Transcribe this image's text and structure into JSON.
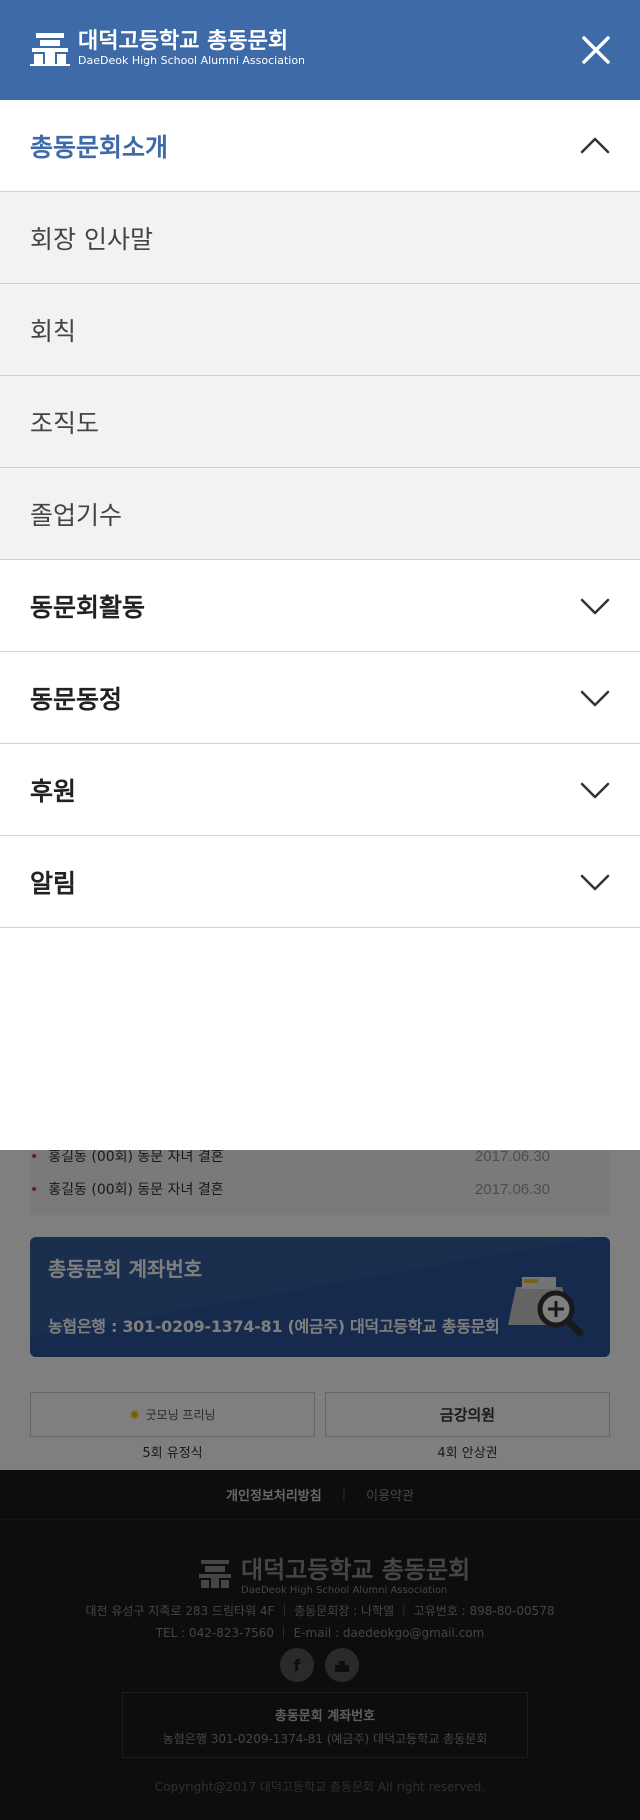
{
  "header": {
    "logo_kr": "대덕고등학교 총동문회",
    "logo_en": "DaeDeok High School Alumni Association"
  },
  "menu": {
    "items": [
      {
        "label": "총동문회소개",
        "expanded": true,
        "children": [
          {
            "label": "회장 인사말"
          },
          {
            "label": "회칙"
          },
          {
            "label": "조직도"
          },
          {
            "label": "졸업기수"
          }
        ]
      },
      {
        "label": "동문회활동",
        "expanded": false
      },
      {
        "label": "동문동정",
        "expanded": false
      },
      {
        "label": "후원",
        "expanded": false
      },
      {
        "label": "알림",
        "expanded": false
      }
    ]
  },
  "background": {
    "news": [
      {
        "title": "홍길동 (00회) 동문 자녀 결혼",
        "date": "2017.06.30"
      },
      {
        "title": "홍길동 (00회) 동문 자녀 결혼",
        "date": "2017.06.30"
      }
    ],
    "account_title": "총동문회 계좌번호",
    "account_number": "농협은행 : 301-0209-1374-81  (예금주) 대덕고등학교 총동문회",
    "sponsors": [
      {
        "name": "굿모닝 프리닝",
        "caption": "5회 유정식"
      },
      {
        "name": "금강의원",
        "caption": "4회 안상권"
      }
    ],
    "footer": {
      "privacy": "개인정보처리방침",
      "terms": "이용약관",
      "logo_kr": "대덕고등학교 총동문회",
      "logo_en": "DaeDeok High School Alumni Association",
      "address_line": "대전 유성구 지족로 283 드림타워 4F   ｜   총동문회장 : 나학엘   ｜   고유번호 : 898-80-00578",
      "contact_line": "TEL : 042-823-7560   ｜   E-mail : daedeokgo@gmail.com",
      "account_title": "총동문회 계좌번호",
      "account_number": "농협은행 301-0209-1374-81 (예금주) 대덕고등학교 총동문회",
      "copyright": "Copyright@2017 대덕고등학교 총동문회 All right reserved."
    }
  },
  "colors": {
    "header_bg": "#3e6aa8",
    "active_text": "#3e6aa8",
    "overlay": "rgba(0,0,0,0.5)"
  }
}
